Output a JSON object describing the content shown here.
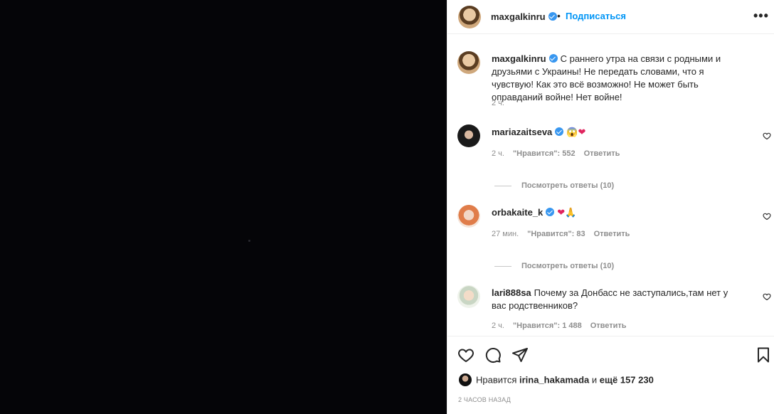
{
  "post": {
    "author": "maxgalkinru",
    "follow_label": "Подписаться",
    "header_dot": "•",
    "more_label": "•••",
    "caption": "С раннего утра на связи с родными и друзьями с Украины! Не передать словами, что я чувствую! Как это всё возможно! Не может быть оправданий войне! Нет войне!",
    "caption_time": "2 ч."
  },
  "comments": [
    {
      "user": "mariazaitseva",
      "verified": true,
      "text_emoji_1": "😱",
      "text_emoji_2": "❤",
      "time": "2 ч.",
      "likes": "\"Нравится\": 552",
      "reply": "Ответить",
      "view_replies": "Посмотреть ответы (10)"
    },
    {
      "user": "orbakaite_k",
      "verified": true,
      "text_emoji_1": "❤",
      "text_emoji_2": "🙏",
      "time": "27 мин.",
      "likes": "\"Нравится\": 83",
      "reply": "Ответить",
      "view_replies": "Посмотреть ответы (10)"
    },
    {
      "user": "lari888sa",
      "verified": false,
      "text": "Почему за Донбасс не заступались,там нет у вас родственников?",
      "time": "2 ч.",
      "likes": "\"Нравится\": 1 488",
      "reply": "Ответить"
    }
  ],
  "footer": {
    "liked_by_prefix": "Нравится",
    "liked_by_user": "irina_hakamada",
    "liked_by_and": "и",
    "liked_by_more": "ещё 157 230",
    "time_ago": "2 ЧАСОВ НАЗАД"
  },
  "icons": [
    "heart-icon",
    "comment-icon",
    "share-icon",
    "bookmark-icon",
    "more-icon",
    "verified-icon"
  ],
  "colors": {
    "link": "#0095f6",
    "verified": "#3897f0",
    "muted": "#8e8e8e",
    "media_bg": "#050508"
  }
}
